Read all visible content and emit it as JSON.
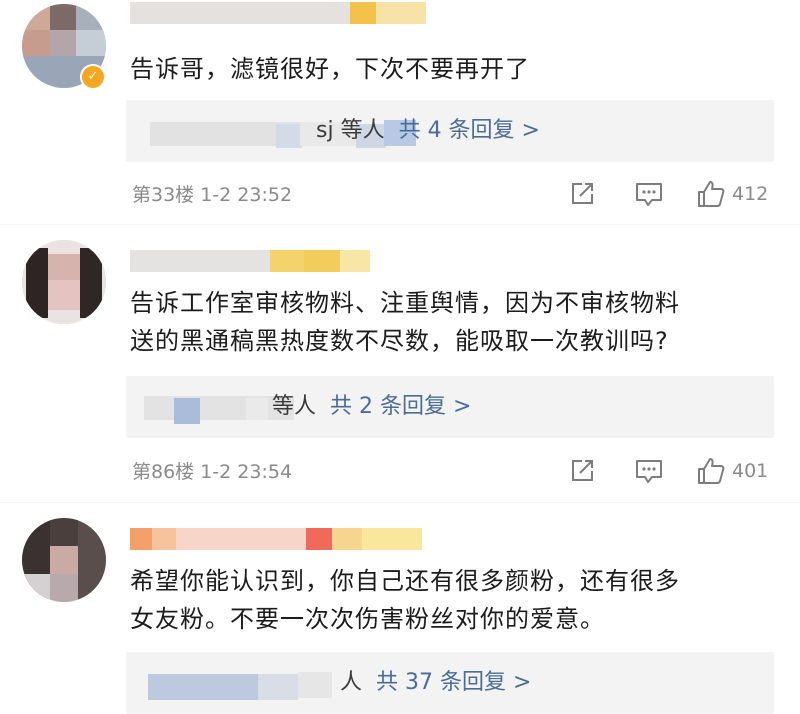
{
  "comments": [
    {
      "text": "告诉哥，滤镜很好，下次不要再开了",
      "reply_tail": "sj 等人",
      "reply_link": "共 4 条回复 >",
      "meta": "第33楼 1-2 23:52",
      "likes": "412"
    },
    {
      "text_line1": "告诉工作室审核物料、注重舆情，因为不审核物料",
      "text_line2": "送的黑通稿黑热度数不尽数，能吸取一次教训吗?",
      "reply_tail": "等人",
      "reply_link": "共 2 条回复 >",
      "meta": "第86楼 1-2 23:54",
      "likes": "401"
    },
    {
      "text_line1": "希望你能认识到，你自己还有很多颜粉，还有很多",
      "text_line2": "女友粉。不要一次次伤害粉丝对你的爱意。",
      "reply_tail": "人",
      "reply_link": "共 37 条回复 >"
    }
  ],
  "icons": {
    "share": "share-icon",
    "comment": "comment-icon",
    "like": "thumbs-up-icon"
  },
  "colors": {
    "link": "#4a6c97",
    "meta": "#8a8a8a",
    "reply_bg": "#f3f3f3",
    "verified": "#f5a623"
  }
}
